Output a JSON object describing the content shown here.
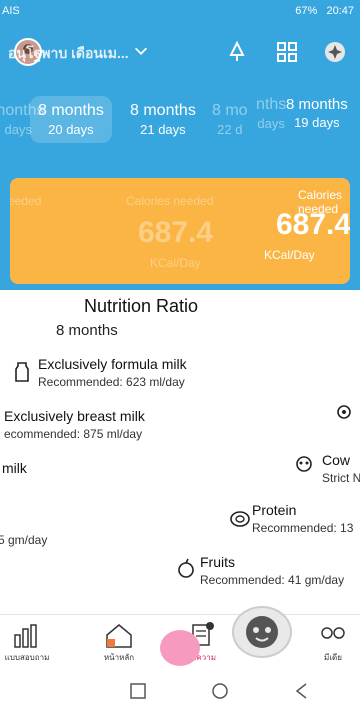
{
  "status_bar": {
    "carrier": "AIS",
    "battery": "67%",
    "time": "20:47"
  },
  "header": {
    "child_name": "อนุโฐพาบ เดือนเม...",
    "icons": [
      "avatar",
      "chevron-down-icon",
      "bell-icon",
      "grid-icon",
      "sparkle-icon"
    ]
  },
  "age_tabs": [
    {
      "months": "months",
      "days": "days"
    },
    {
      "months": "8 months",
      "days": "20 days"
    },
    {
      "months": "8 months",
      "days": "21 days"
    },
    {
      "months": "8 mo",
      "days": "22 d"
    },
    {
      "months": "nths",
      "days": "days"
    },
    {
      "months": "8 months",
      "days": "19 days"
    }
  ],
  "calories": {
    "label": "Calories needed",
    "value": "687.4",
    "unit": "KCal/Day",
    "ghost_label": "eeded"
  },
  "nutrition": {
    "title": "Nutrition Ratio",
    "age": "8 months",
    "items": [
      {
        "name": "Exclusively formula milk",
        "rec": "Recommended: 623 ml/day"
      },
      {
        "name": "Exclusively breast milk",
        "rec": "ecommended: 875 ml/day"
      },
      {
        "name": "milk",
        "rec": ""
      },
      {
        "name": "Cow",
        "rec": "Strict NO"
      },
      {
        "name": "Protein",
        "rec": "Recommended: 13"
      },
      {
        "name": "",
        "rec": "5 gm/day"
      },
      {
        "name": "Fruits",
        "rec": "Recommended: 41 gm/day"
      }
    ]
  },
  "bottom_nav": [
    {
      "label": "แบบสอบถาม",
      "icon": "bar-chart-icon"
    },
    {
      "label": "หน้าหลัก",
      "icon": "home-icon"
    },
    {
      "label": "บทความ",
      "icon": "article-icon"
    },
    {
      "label": "",
      "icon": "baby-face-icon"
    },
    {
      "label": "มีเดีย",
      "icon": "media-icon"
    }
  ],
  "colors": {
    "primary": "#37a6de",
    "card": "#fbb545",
    "pink": "#f79ac0"
  }
}
